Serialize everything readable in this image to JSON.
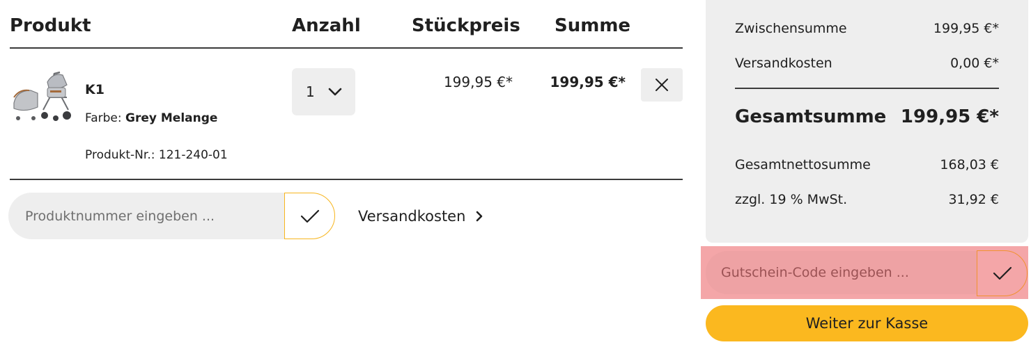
{
  "cart": {
    "headers": {
      "product": "Produkt",
      "quantity": "Anzahl",
      "unit_price": "Stückpreis",
      "total": "Summe"
    },
    "item": {
      "name": "K1",
      "color_label": "Farbe:",
      "color_value": "Grey Melange",
      "sku_label": "Produkt-Nr.:",
      "sku_value": "121-240-01",
      "quantity": "1",
      "unit_price": "199,95 €*",
      "total": "199,95 €*",
      "image_icon": "stroller-image"
    },
    "sku_form": {
      "placeholder": "Produktnummer eingeben ..."
    },
    "shipping_link": "Versandkosten"
  },
  "summary": {
    "subtotal_label": "Zwischensumme",
    "subtotal_value": "199,95 €*",
    "shipping_label": "Versandkosten",
    "shipping_value": "0,00 €*",
    "total_label": "Gesamtsumme",
    "total_value": "199,95 €*",
    "net_label": "Gesamtnettosumme",
    "net_value": "168,03 €",
    "tax_label": "zzgl. 19 % MwSt.",
    "tax_value": "31,92 €"
  },
  "voucher": {
    "placeholder": "Gutschein-Code eingeben ..."
  },
  "checkout_label": "Weiter zur Kasse",
  "colors": {
    "accent": "#fbb81f",
    "panel": "#eeeeee",
    "highlight": "#f4a6a8"
  }
}
